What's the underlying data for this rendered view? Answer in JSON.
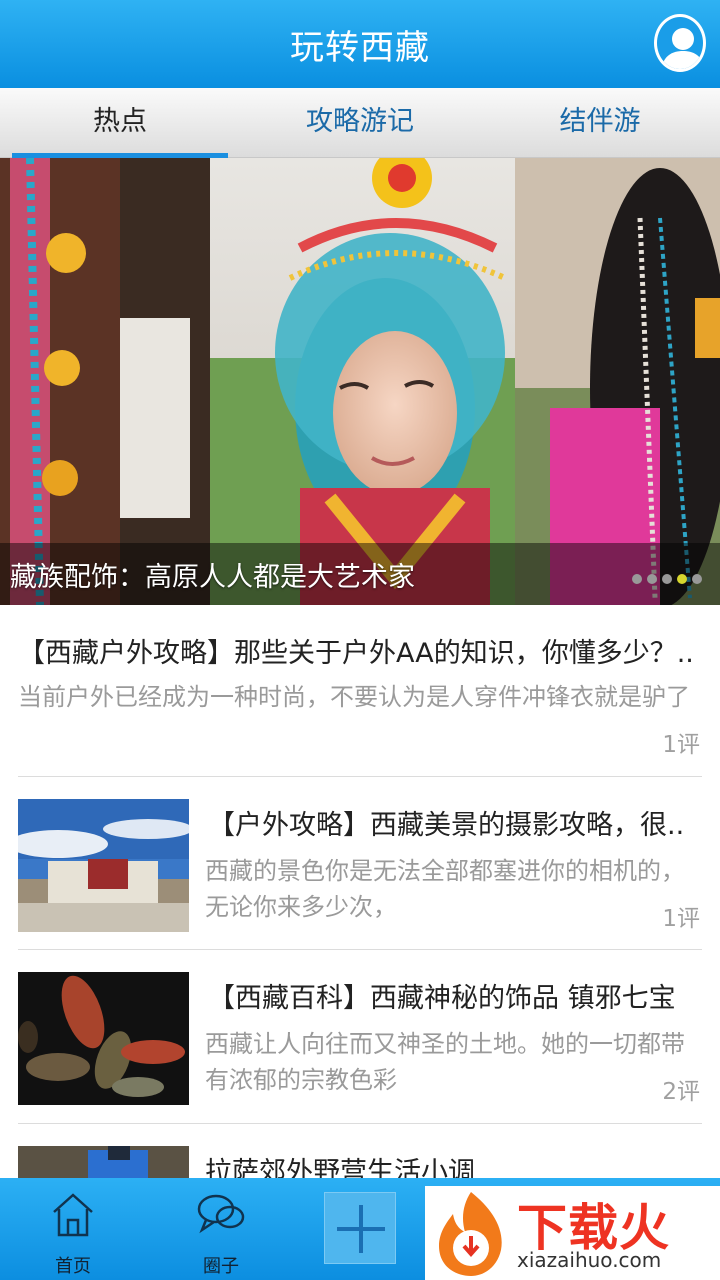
{
  "app": {
    "title": "玩转西藏"
  },
  "icons": {
    "avatar": "user-avatar-icon",
    "home": "home-icon",
    "circle": "chat-bubbles-icon",
    "plus": "plus-icon"
  },
  "colors": {
    "primary": "#1a8fe0",
    "tab_active_indicator": "#1a8fe0",
    "dot_active": "#d6d62e"
  },
  "tabs": [
    {
      "label": "热点",
      "active": true
    },
    {
      "label": "攻略游记",
      "active": false
    },
    {
      "label": "结伴游",
      "active": false
    }
  ],
  "banner": {
    "caption": "藏族配饰：高原人人都是大艺术家",
    "dots_total": 5,
    "dot_active_index": 3
  },
  "feed": [
    {
      "title": "【西藏户外攻略】那些关于户外AA的知识，你懂多少？..",
      "summary": "当前户外已经成为一种时尚，不要认为是人穿件冲锋衣就是驴了",
      "comments": "1评"
    },
    {
      "title": "【户外攻略】西藏美景的摄影攻略，很..",
      "summary_line1": "西藏的景色你是无法全部都塞进你的相机的，",
      "summary_line2": "无论你来多少次，",
      "comments": "1评"
    },
    {
      "title": "【西藏百科】西藏神秘的饰品  镇邪七宝",
      "summary_line1": "西藏让人向往而又神圣的土地。她的一切都带",
      "summary_line2": "有浓郁的宗教色彩",
      "comments": "2评"
    },
    {
      "title": "拉萨郊外野营生活小调"
    }
  ],
  "bottom_nav": [
    {
      "label": "首页"
    },
    {
      "label": "圈子"
    }
  ],
  "watermark": {
    "text": "下载火",
    "url": "xiazaihuo.com"
  }
}
